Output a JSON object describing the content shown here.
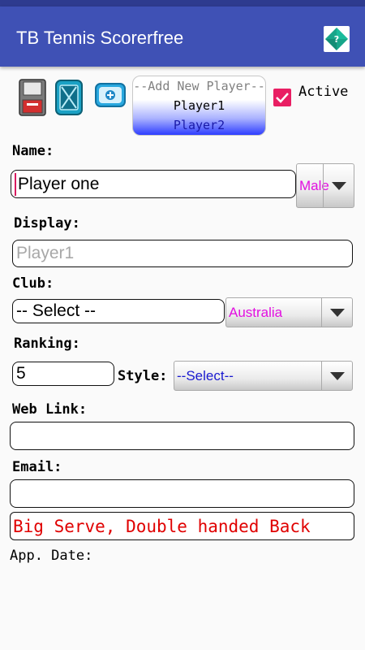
{
  "app": {
    "title": "TB Tennis Scorerfree"
  },
  "toolbar": {
    "icons": [
      "save-icon",
      "clear-icon",
      "add-icon"
    ],
    "player_list": {
      "header": "--Add New Player--",
      "items": [
        "Player1",
        "Player2"
      ]
    },
    "active_checked": true,
    "active_label": "Active"
  },
  "form": {
    "name_label": "Name:",
    "name_value": "Player one",
    "gender_value": "Male",
    "display_label": "Display:",
    "display_placeholder": "Player1",
    "club_label": "Club:",
    "club_value": "-- Select --",
    "country_value": "Australia",
    "ranking_label": "Ranking:",
    "ranking_value": "5",
    "style_label": "Style:",
    "style_value": "--Select--",
    "weblink_label": "Web Link:",
    "weblink_value": "",
    "email_label": "Email:",
    "email_value": "",
    "notes_value": "Big Serve, Double handed Back",
    "appdate_label": "App. Date:"
  },
  "colors": {
    "appbar": "#3f51b5",
    "checkbox": "#e91e63",
    "magenta_text": "#e20fe0",
    "blue_text": "#1a1ad0",
    "notes_text": "#e00000"
  }
}
